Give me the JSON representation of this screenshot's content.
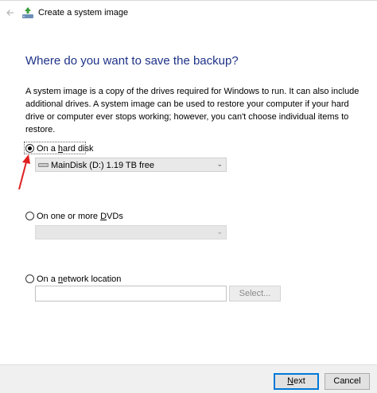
{
  "titlebar": {
    "title": "Create a system image",
    "back_icon": "back-arrow-icon",
    "app_icon": "backup-icon"
  },
  "heading": "Where do you want to save the backup?",
  "description": "A system image is a copy of the drives required for Windows to run. It can also include additional drives. A system image can be used to restore your computer if your hard drive or computer ever stops working; however, you can't choose individual items to restore.",
  "options": {
    "hard_disk": {
      "label_pre": "On a ",
      "label_key": "h",
      "label_post": "ard disk",
      "selected": true
    },
    "dvds": {
      "label_pre": "On one or more ",
      "label_key": "D",
      "label_post": "VDs",
      "selected": false
    },
    "network": {
      "label_pre": "On a ",
      "label_key": "n",
      "label_post": "etwork location",
      "selected": false
    }
  },
  "hard_disk_select": {
    "value": "MainDisk (D:)  1.19 TB free"
  },
  "dvd_select": {
    "value": ""
  },
  "network": {
    "location_value": "",
    "select_button": "Select..."
  },
  "footer": {
    "next_pre": "",
    "next_key": "N",
    "next_post": "ext",
    "cancel": "Cancel"
  },
  "colors": {
    "heading": "#1e3287",
    "accent": "#0078d7",
    "annotation_arrow": "#e02020"
  }
}
